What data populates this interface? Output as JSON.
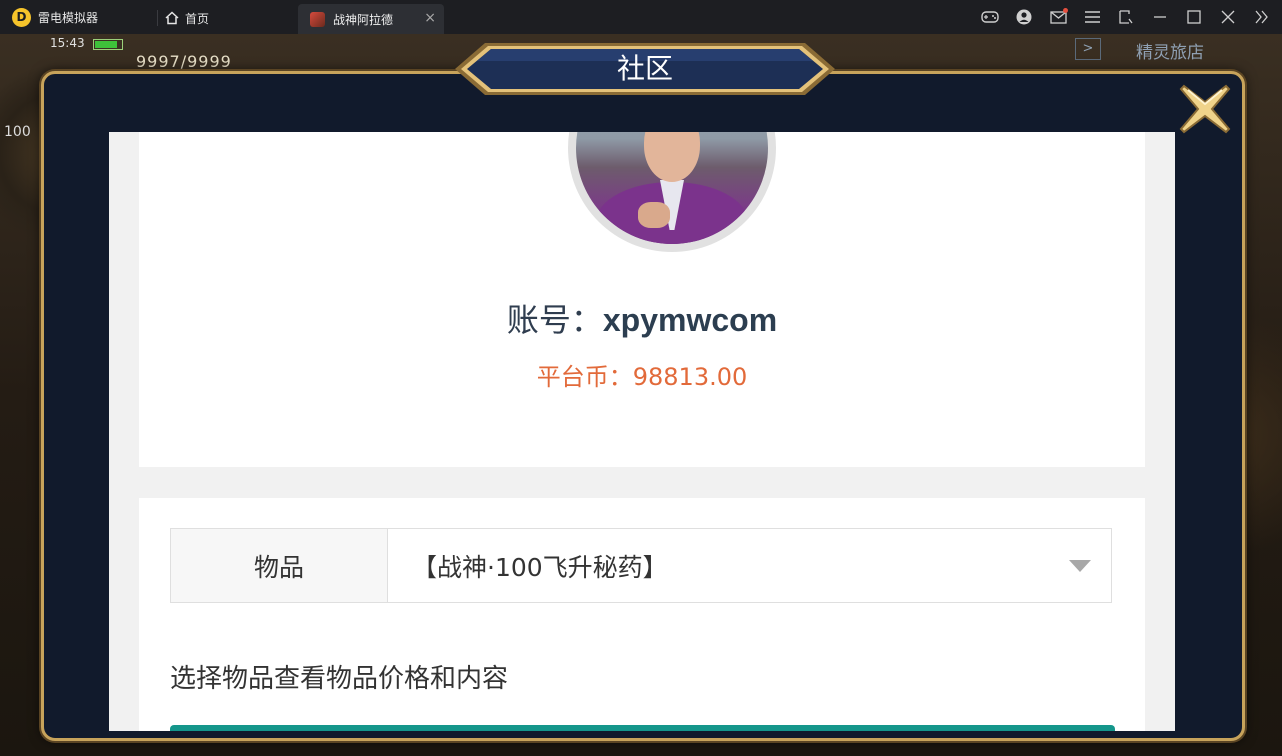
{
  "emulator": {
    "app_title": "雷电模拟器",
    "home_tab_label": "首页",
    "game_tab_label": "战神阿拉德",
    "tab_close_glyph": "×"
  },
  "game": {
    "status_time": "15:43",
    "hp_text": "9997/9999",
    "shop_label": "精灵旅店",
    "level_badge": "100"
  },
  "modal": {
    "title": "社区"
  },
  "profile": {
    "account_label": "账号：",
    "account_name": "xpymwcom",
    "coins_label": "平台币：",
    "coins_value": "98813.00"
  },
  "items": {
    "select_label": "物品",
    "selected_value": "【战神·100飞升秘药】",
    "hint": "选择物品查看物品价格和内容"
  },
  "colors": {
    "accent_teal": "#14968b",
    "coins_orange": "#e26a3a",
    "modal_gold": "#c7a35b",
    "modal_navy": "#111a2c"
  }
}
